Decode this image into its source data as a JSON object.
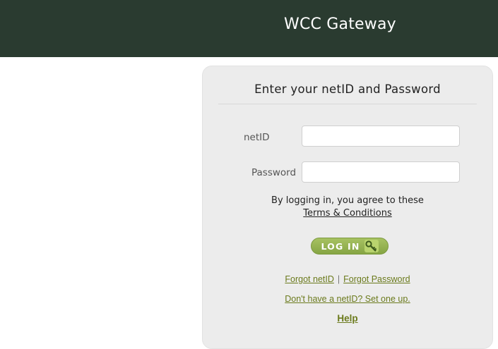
{
  "header": {
    "title": "WCC Gateway"
  },
  "login": {
    "heading": "Enter your netID and Password",
    "netid_label": "netID",
    "netid_value": "",
    "password_label": "Password",
    "password_value": "",
    "agree_text": "By logging in, you agree to these",
    "terms_link": "Terms & Conditions",
    "login_button": "LOG IN",
    "forgot_netid": "Forgot netID",
    "separator": "|",
    "forgot_password": "Forgot Password",
    "setup_link": "Don't have a netID? Set one up.",
    "help_link": "Help"
  },
  "colors": {
    "header_bg": "#2a3b30",
    "panel_bg": "#ececec",
    "button_green": "#94b04f",
    "link_olive": "#6b7a1c"
  },
  "icons": {
    "login_button_icon": "key-icon"
  }
}
